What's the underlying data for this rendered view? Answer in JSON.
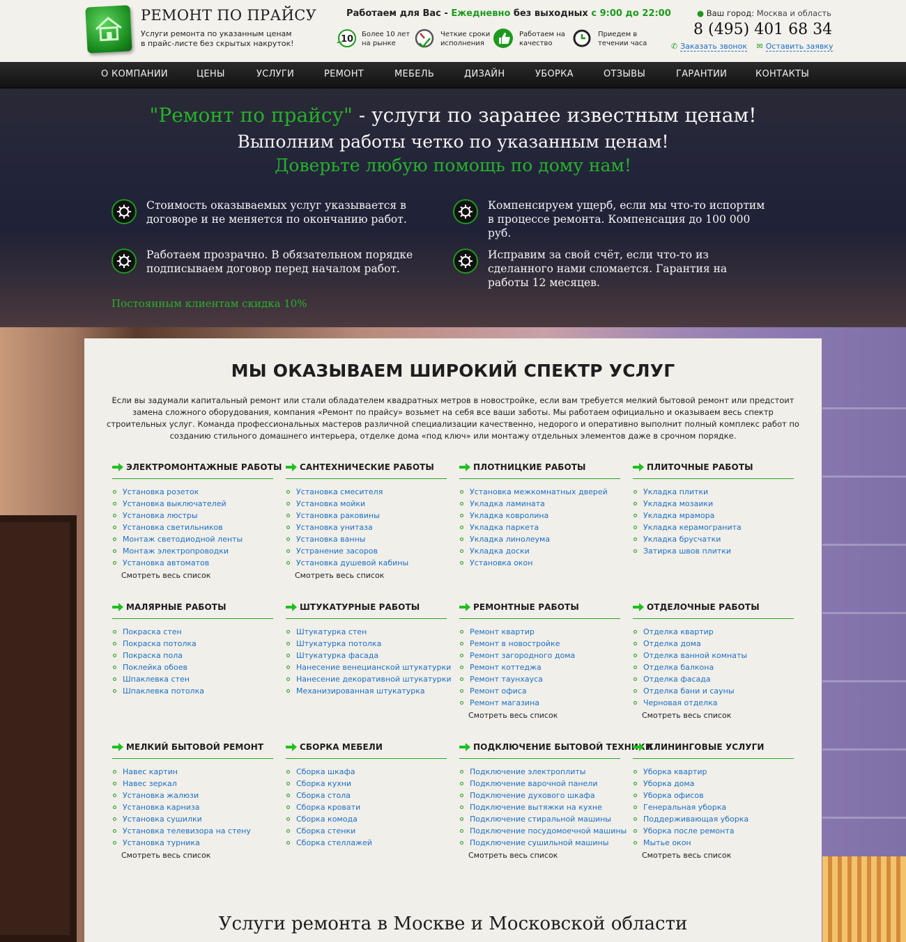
{
  "header": {
    "logo_title": "РЕМОНТ ПО ПРАЙСУ",
    "logo_subtitle": "Услуги ремонта по указанным ценам в прайс-листе без скрытых накруток!",
    "work_time_prefix": "Работаем для Вас - ",
    "work_time_days": "Ежедневно",
    "work_time_mid": " без выходных ",
    "work_time_hours": "с 9:00 до 22:00",
    "features": [
      {
        "icon": "ten-years-badge-icon",
        "text": "Более 10 лет на рынке"
      },
      {
        "icon": "speedometer-icon",
        "text": "Четкие сроки исполнения"
      },
      {
        "icon": "thumbs-up-icon",
        "text": "Работаем на качество"
      },
      {
        "icon": "clock-icon",
        "text": "Приедем в течении часа"
      }
    ],
    "city_label": "Ваш город:",
    "city_value": "Москва и область",
    "phone": "8 (495) 401 68 34",
    "callback_label": "Заказать звонок",
    "request_label": "Оставить заявку"
  },
  "nav": [
    "О КОМПАНИИ",
    "ЦЕНЫ",
    "УСЛУГИ",
    "РЕМОНТ",
    "МЕБЕЛЬ",
    "ДИЗАЙН",
    "УБОРКА",
    "ОТЗЫВЫ",
    "ГАРАНТИИ",
    "КОНТАКТЫ"
  ],
  "hero": {
    "line1_accent": "\"Ремонт по прайсу\"",
    "line1_rest": " - услуги по заранее известным ценам!",
    "line2": "Выполним работы четко по указанным ценам!",
    "line3": "Доверьте любую помощь по дому нам!",
    "items": [
      "Стоимость оказываемых услуг указывается в договоре и не меняется по окончанию работ.",
      "Компенсируем ущерб, если мы что-то испортим в процессе ремонта. Компенсация до 100 000 руб.",
      "Работаем прозрачно. В обязательном порядке подписываем договор перед началом работ.",
      "Исправим за свой счёт, если что-то из сделанного нами сломается. Гарантия на работы 12 месяцев."
    ],
    "discount": "Постоянным клиентам скидка 10%"
  },
  "services": {
    "title": "МЫ ОКАЗЫВАЕМ ШИРОКИЙ СПЕКТР УСЛУГ",
    "intro": "Если вы задумали капитальный ремонт или стали обладателем квадратных метров в новостройке, если вам требуется мелкий бытовой ремонт или предстоит замена сложного оборудования, компания «Ремонт по прайсу» возьмет на себя все ваши заботы. Мы работаем официально и оказываем весь спектр строительных услуг. Команда профессиональных мастеров различной специализации качественно, недорого и оперативно выполнит полный комплекс работ по созданию стильного домашнего интерьера, отделке дома «под ключ» или монтажу отдельных элементов даже в срочном порядке.",
    "more_label": "Смотреть весь список",
    "categories": [
      {
        "title": "ЭЛЕКТРОМОНТАЖНЫЕ РАБОТЫ",
        "more": true,
        "items": [
          "Установка розеток",
          "Установка выключателей",
          "Установка люстры",
          "Установка светильников",
          "Монтаж светодиодной ленты",
          "Монтаж электропроводки",
          "Установка автоматов"
        ]
      },
      {
        "title": "САНТЕХНИЧЕСКИЕ РАБОТЫ",
        "more": true,
        "items": [
          "Установка смесителя",
          "Установка мойки",
          "Установка раковины",
          "Установка унитаза",
          "Установка ванны",
          "Устранение засоров",
          "Установка душевой кабины"
        ]
      },
      {
        "title": "ПЛОТНИЦКИЕ РАБОТЫ",
        "more": false,
        "items": [
          "Установка межкомнатных дверей",
          "Укладка ламината",
          "Укладка ковролина",
          "Укладка паркета",
          "Укладка линолеума",
          "Укладка доски",
          "Установка окон"
        ]
      },
      {
        "title": "ПЛИТОЧНЫЕ РАБОТЫ",
        "more": false,
        "items": [
          "Укладка плитки",
          "Укладка мозаики",
          "Укладка мрамора",
          "Укладка керамогранита",
          "Укладка брусчатки",
          "Затирка швов плитки"
        ]
      },
      {
        "title": "МАЛЯРНЫЕ РАБОТЫ",
        "more": false,
        "items": [
          "Покраска стен",
          "Покраска потолка",
          "Покраска пола",
          "Поклейка обоев",
          "Шпаклевка стен",
          "Шпаклевка потолка"
        ]
      },
      {
        "title": "ШТУКАТУРНЫЕ РАБОТЫ",
        "more": false,
        "items": [
          "Штукатурка стен",
          "Штукатурка потолка",
          "Штукатурка фасада",
          "Нанесение венецианской штукатурки",
          "Нанесение декоративной штукатурки",
          "Механизированная штукатурка"
        ]
      },
      {
        "title": "РЕМОНТНЫЕ РАБОТЫ",
        "more": true,
        "items": [
          "Ремонт квартир",
          "Ремонт в новостройке",
          "Ремонт загородного дома",
          "Ремонт коттеджа",
          "Ремонт таунхауса",
          "Ремонт офиса",
          "Ремонт магазина"
        ]
      },
      {
        "title": "ОТДЕЛОЧНЫЕ РАБОТЫ",
        "more": true,
        "items": [
          "Отделка квартир",
          "Отделка дома",
          "Отделка ванной комнаты",
          "Отделка балкона",
          "Отделка фасада",
          "Отделка бани и сауны",
          "Черновая отделка"
        ]
      },
      {
        "title": "МЕЛКИЙ БЫТОВОЙ РЕМОНТ",
        "more": true,
        "items": [
          "Навес картин",
          "Навес зеркал",
          "Установка жалюзи",
          "Установка карниза",
          "Установка сушилки",
          "Установка телевизора на стену",
          "Установка турника"
        ]
      },
      {
        "title": "СБОРКА МЕБЕЛИ",
        "more": false,
        "items": [
          "Сборка шкафа",
          "Сборка кухни",
          "Сборка стола",
          "Сборка кровати",
          "Сборка комода",
          "Сборка стенки",
          "Сборка стеллажей"
        ]
      },
      {
        "title": "ПОДКЛЮЧЕНИЕ БЫТОВОЙ ТЕХНИКИ",
        "more": true,
        "items": [
          "Подключение электроплиты",
          "Подключение варочной панели",
          "Подключение духового шкафа",
          "Подключение вытяжки на кухне",
          "Подключение стиральной машины",
          "Подключение посудомоечной машины",
          "Подключение сушильной машины"
        ]
      },
      {
        "title": "КЛИНИНГОВЫЕ УСЛУГИ",
        "more": true,
        "items": [
          "Уборка квартир",
          "Уборка дома",
          "Уборка офисов",
          "Генеральная уборка",
          "Поддерживающая уборка",
          "Уборка после ремонта",
          "Мытье окон"
        ]
      }
    ],
    "bottom_title": "Услуги ремонта в Москве и Московской области"
  },
  "colors": {
    "accent_green": "#27b12a",
    "link_blue": "#1b6fc6",
    "nav_bg": "#1a1a1a"
  }
}
